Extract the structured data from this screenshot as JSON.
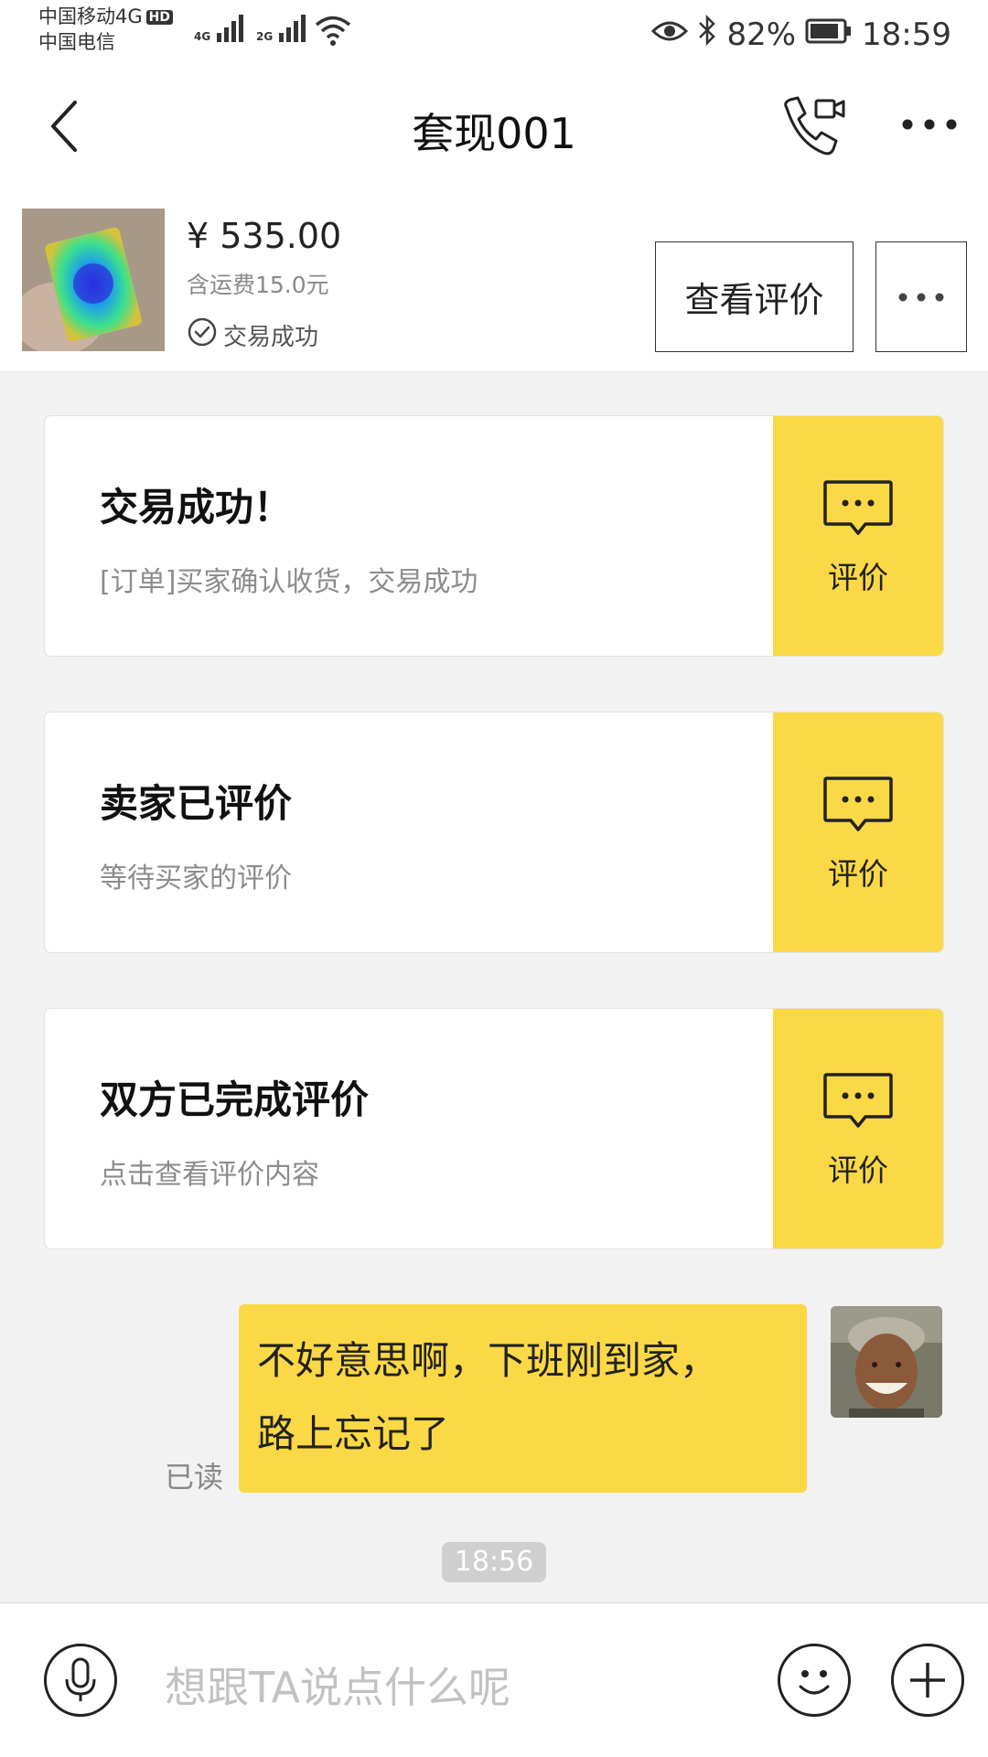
{
  "status_bar": {
    "carrier1": "中国移动4G",
    "hd": "HD",
    "carrier2": "中国电信",
    "sig1": "4G",
    "sig2": "2G",
    "battery": "82%",
    "time": "18:59"
  },
  "header": {
    "title": "套现001"
  },
  "product": {
    "price": "¥ 535.00",
    "shipping": "含运费15.0元",
    "status": "交易成功",
    "review_button": "查看评价"
  },
  "cards": [
    {
      "title": "交易成功！",
      "subtitle": "[订单]买家确认收货，交易成功",
      "action": "评价"
    },
    {
      "title": "卖家已评价",
      "subtitle": "等待买家的评价",
      "action": "评价"
    },
    {
      "title": "双方已完成评价",
      "subtitle": "点击查看评价内容",
      "action": "评价"
    }
  ],
  "message": {
    "line1": "不好意思啊，下班刚到家，",
    "line2": "路上忘记了",
    "read_label": "已读",
    "timestamp": "18:56"
  },
  "input": {
    "placeholder": "想跟TA说点什么呢"
  },
  "colors": {
    "accent": "#fbd845",
    "background": "#f2f2f2"
  }
}
